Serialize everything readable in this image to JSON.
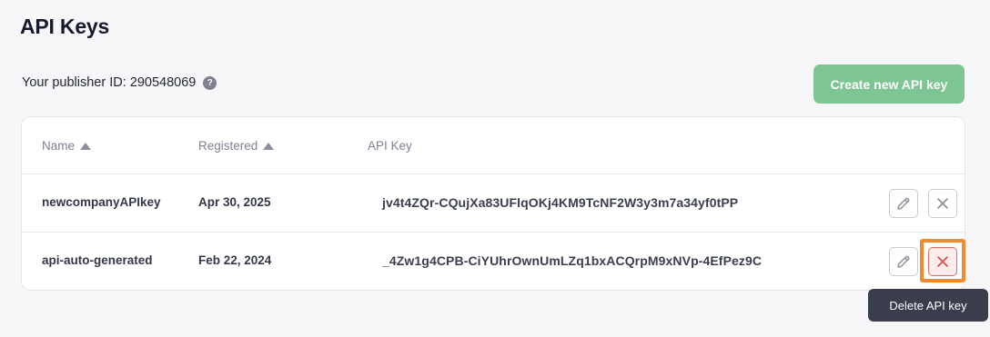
{
  "page": {
    "title": "API Keys",
    "publisher_label": "Your publisher ID: 290548069",
    "help_icon_glyph": "?",
    "create_button_label": "Create new API key"
  },
  "table": {
    "headers": {
      "name": "Name",
      "registered": "Registered",
      "api_key": "API Key"
    },
    "rows": [
      {
        "name": "newcompanyAPIkey",
        "registered": "Apr 30, 2025",
        "api_key": "jv4t4ZQr-CQujXa83UFlqOKj4KM9TcNF2W3y3m7a34yf0tPP"
      },
      {
        "name": "api-auto-generated",
        "registered": "Feb 22, 2024",
        "api_key": "_4Zw1g4CPB-CiYUhrOwnUmLZq1bxACQrpM9xNVp-4EfPez9C"
      }
    ]
  },
  "tooltip": {
    "text": "Delete API key"
  },
  "colors": {
    "create_button": "#7dc694",
    "highlight": "#f08a2c",
    "delete_active": "#e26b63"
  },
  "icons": {
    "edit": "pencil-icon",
    "delete": "close-icon",
    "sort": "sort-ascending-icon"
  }
}
